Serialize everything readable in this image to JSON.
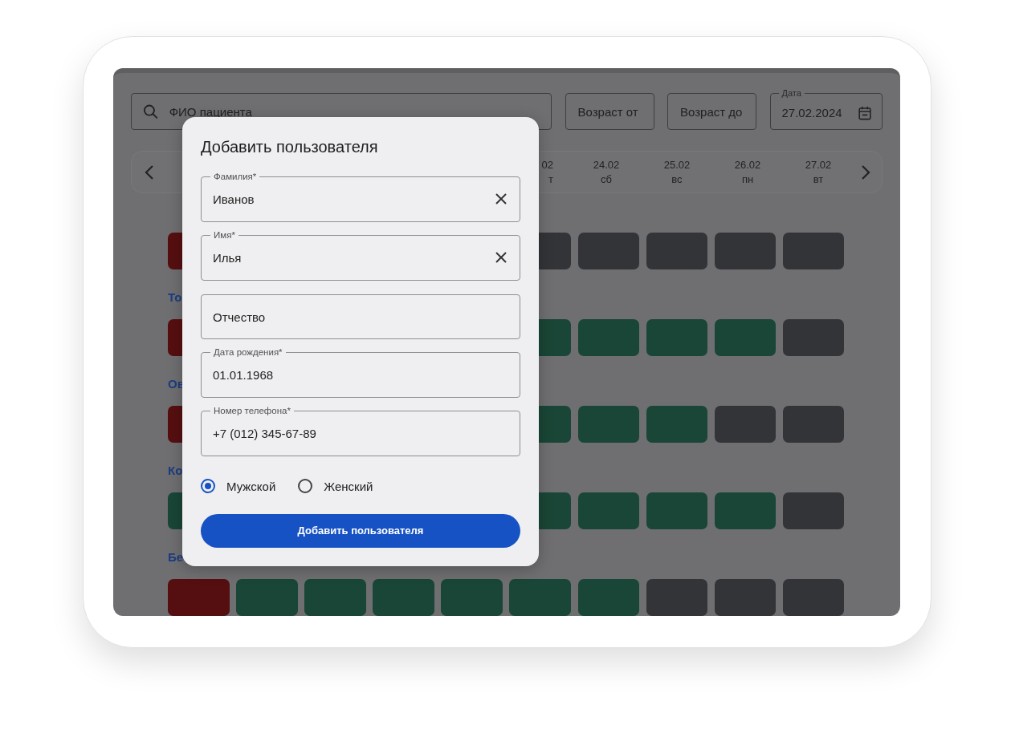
{
  "search": {
    "placeholder": "ФИО пациента"
  },
  "filters": [
    {
      "placeholder": "Возраст от"
    },
    {
      "placeholder": "Возраст до"
    }
  ],
  "date_field": {
    "label": "Дата",
    "value": "27.02.2024"
  },
  "date_strip": {
    "days": [
      {
        "date": "02",
        "weekday": "т"
      },
      {
        "date": "24.02",
        "weekday": "сб"
      },
      {
        "date": "25.02",
        "weekday": "вс"
      },
      {
        "date": "26.02",
        "weekday": "пн"
      },
      {
        "date": "27.02",
        "weekday": "вт"
      }
    ]
  },
  "schedule": {
    "rows": [
      {
        "slots": [
          {
            "color": "#560f10"
          },
          {
            "color": "#333438"
          },
          {
            "color": "#333438"
          },
          {
            "color": "#333438"
          },
          {
            "color": "#333438"
          },
          {
            "color": "#333438"
          }
        ]
      },
      {
        "name": "То",
        "slots": [
          {
            "color": "#560f10"
          },
          {
            "color": "#194636"
          },
          {
            "color": "#194636"
          },
          {
            "color": "#194636"
          },
          {
            "color": "#194636"
          },
          {
            "color": "#333438"
          }
        ]
      },
      {
        "name": "Ов",
        "slots": [
          {
            "color": "#560f10"
          },
          {
            "color": "#194636"
          },
          {
            "color": "#194636"
          },
          {
            "color": "#194636"
          },
          {
            "color": "#333438"
          },
          {
            "color": "#333438"
          }
        ]
      },
      {
        "name": "Ко",
        "slots": [
          {
            "color": "#194636"
          },
          {
            "color": "#194636"
          },
          {
            "color": "#194636"
          },
          {
            "color": "#194636"
          },
          {
            "color": "#194636"
          },
          {
            "color": "#333438"
          }
        ]
      },
      {
        "name": "Бе",
        "slots": [
          {
            "color": "#560f10"
          },
          {
            "color": "#194636"
          },
          {
            "color": "#194636"
          },
          {
            "color": "#194636"
          },
          {
            "color": "#194636"
          },
          {
            "color": "#194636"
          },
          {
            "color": "#194636"
          },
          {
            "color": "#333438"
          },
          {
            "color": "#333438"
          },
          {
            "color": "#333438"
          }
        ]
      }
    ]
  },
  "dialog": {
    "title": "Добавить пользователя",
    "fields": [
      {
        "label": "Фамилия*",
        "value": "Иванов",
        "clearable": true
      },
      {
        "label": "Имя*",
        "value": "Илья",
        "clearable": true
      },
      {
        "placeholder": "Отчество",
        "clearable": false
      },
      {
        "label": "Дата рождения*",
        "value": "01.01.1968",
        "clearable": false
      },
      {
        "label": "Номер телефона*",
        "value": "+7 (012) 345-67-89",
        "clearable": false
      }
    ],
    "gender": [
      {
        "label": "Мужской",
        "selected": true
      },
      {
        "label": "Женский",
        "selected": false
      }
    ],
    "submit": "Добавить пользователя"
  }
}
